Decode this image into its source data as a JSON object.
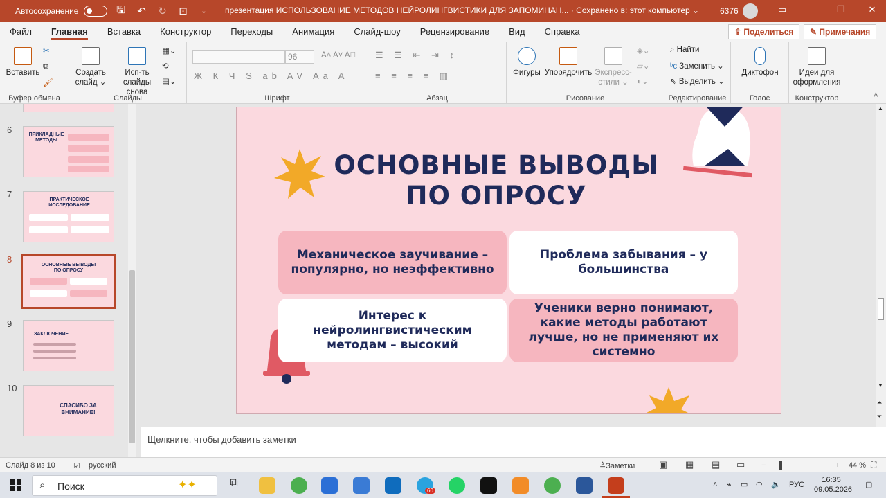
{
  "titlebar": {
    "autosave_label": "Автосохранение",
    "doc_title": "презентация ИСПОЛЬЗОВАНИЕ МЕТОДОВ НЕЙРОЛИНГВИСТИКИ ДЛЯ ЗАПОМИНАН...  ·  Сохранено в: этот компьютер ⌄",
    "account_number": "6376"
  },
  "tabs": [
    "Файл",
    "Главная",
    "Вставка",
    "Конструктор",
    "Переходы",
    "Анимация",
    "Слайд-шоу",
    "Рецензирование",
    "Вид",
    "Справка"
  ],
  "active_tab": "Главная",
  "share_label": "Поделиться",
  "comments_label": "Примечания",
  "ribbon": {
    "groups": {
      "clipboard": "Буфер обмена",
      "slides": "Слайды",
      "font": "Шрифт",
      "paragraph": "Абзац",
      "drawing": "Рисование",
      "editing": "Редактирование",
      "voice": "Голос",
      "designer": "Конструктор"
    },
    "paste": "Вставить",
    "new_slide_1": "Создать",
    "new_slide_2": "слайд ⌄",
    "reuse_1": "Исп-ть",
    "reuse_2": "слайды снова",
    "font_size": "96",
    "font_style_row": "Ж К Ч S ab AV Aa A",
    "shapes": "Фигуры",
    "arrange": "Упорядочить",
    "quick_styles_1": "Экспресс-",
    "quick_styles_2": "стили ⌄",
    "find": "Найти",
    "replace": "Заменить ⌄",
    "select": "Выделить ⌄",
    "dictate": "Диктофон",
    "design_ideas_1": "Идеи для",
    "design_ideas_2": "оформления"
  },
  "thumbnails": [
    {
      "num": "6",
      "title": "ПРИКЛАДНЫЕ МЕТОДЫ"
    },
    {
      "num": "7",
      "title": "ПРАКТИЧЕСКОЕ ИССЛЕДОВАНИЕ"
    },
    {
      "num": "8",
      "title": "ОСНОВНЫЕ ВЫВОДЫ ПО ОПРОСУ"
    },
    {
      "num": "9",
      "title": "ЗАКЛЮЧЕНИЕ"
    },
    {
      "num": "10",
      "title": "СПАСИБО ЗА ВНИМАНИЕ!"
    }
  ],
  "slide": {
    "title_line1": "ОСНОВНЫЕ ВЫВОДЫ",
    "title_line2": "ПО ОПРОСУ",
    "card1": "Механическое заучивание – популярно, но неэффективно",
    "card2": "Проблема забывания – у большинства",
    "card3": "Интерес к нейролингвистическим методам – высокий",
    "card4": "Ученики верно понимают, какие методы работают лучше, но не применяют их системно"
  },
  "notes_placeholder": "Щелкните, чтобы добавить заметки",
  "status": {
    "slide_counter": "Слайд 8 из 10",
    "language": "русский",
    "notes": "Заметки",
    "zoom": "44 %"
  },
  "taskbar": {
    "search_label": "Поиск",
    "lang": "РУС",
    "time": "16:35",
    "date": "09.05.2026",
    "telegram_badge": "60"
  },
  "colors": {
    "accent": "#b7472a",
    "slide_bg": "#fbd9df",
    "navy": "#1f2a5a",
    "pink_card": "#f6b6bf",
    "star": "#f2a928",
    "bell": "#e05a64"
  }
}
